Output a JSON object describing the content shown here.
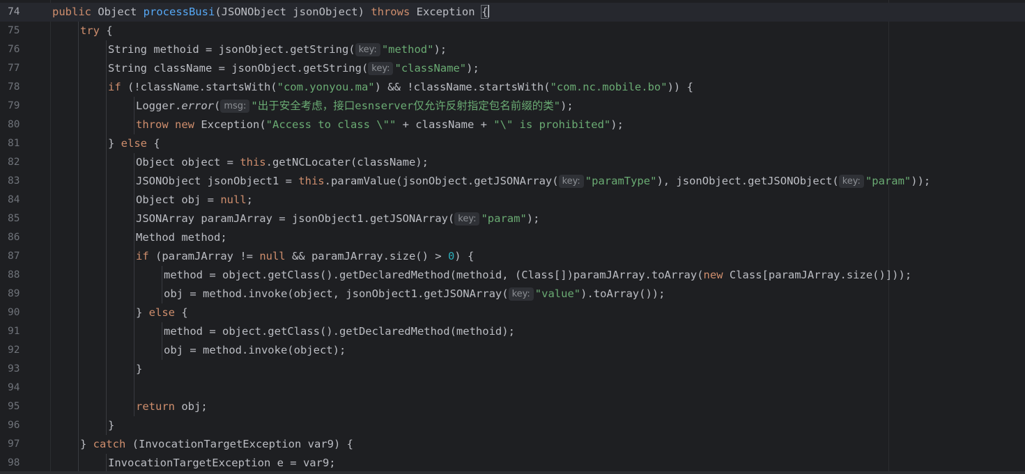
{
  "editor": {
    "lines": [
      {
        "n": "74",
        "indent": 1,
        "current": true,
        "tokens": [
          {
            "t": "public ",
            "c": "kw"
          },
          {
            "t": "Object "
          },
          {
            "t": "processBusi",
            "c": "fn"
          },
          {
            "t": "(JSONObject jsonObject) "
          },
          {
            "t": "throws ",
            "c": "kw"
          },
          {
            "t": "Exception "
          },
          {
            "t": "{",
            "c": "cursor-brace"
          },
          {
            "caret": true
          }
        ]
      },
      {
        "n": "75",
        "indent": 2,
        "tokens": [
          {
            "t": "try ",
            "c": "kw"
          },
          {
            "t": "{"
          }
        ]
      },
      {
        "n": "76",
        "indent": 3,
        "tokens": [
          {
            "t": "String methoid = jsonObject.getString("
          },
          {
            "hint": "key:"
          },
          {
            "t": "\"method\"",
            "c": "str"
          },
          {
            "t": ");"
          }
        ]
      },
      {
        "n": "77",
        "indent": 3,
        "tokens": [
          {
            "t": "String className = jsonObject.getString("
          },
          {
            "hint": "key:"
          },
          {
            "t": "\"className\"",
            "c": "str"
          },
          {
            "t": ");"
          }
        ]
      },
      {
        "n": "78",
        "indent": 3,
        "tokens": [
          {
            "t": "if ",
            "c": "kw"
          },
          {
            "t": "(!className.startsWith("
          },
          {
            "t": "\"com.yonyou.ma\"",
            "c": "str"
          },
          {
            "t": ") && !className.startsWith("
          },
          {
            "t": "\"com.nc.mobile.bo\"",
            "c": "str"
          },
          {
            "t": ")) {"
          }
        ]
      },
      {
        "n": "79",
        "indent": 4,
        "tokens": [
          {
            "t": "Logger."
          },
          {
            "t": "error",
            "c": "it"
          },
          {
            "t": "("
          },
          {
            "hint": "msg:"
          },
          {
            "t": "\"出于安全考虑，接口esnserver仅允许反射指定包名前缀的类\"",
            "c": "str"
          },
          {
            "t": ");"
          }
        ]
      },
      {
        "n": "80",
        "indent": 4,
        "tokens": [
          {
            "t": "throw ",
            "c": "kw"
          },
          {
            "t": "new ",
            "c": "kw"
          },
          {
            "t": "Exception("
          },
          {
            "t": "\"Access to class \\\"\"",
            "c": "str"
          },
          {
            "t": " + className + "
          },
          {
            "t": "\"\\\" is prohibited\"",
            "c": "str"
          },
          {
            "t": ");"
          }
        ]
      },
      {
        "n": "81",
        "indent": 3,
        "tokens": [
          {
            "t": "} "
          },
          {
            "t": "else ",
            "c": "kw"
          },
          {
            "t": "{"
          }
        ]
      },
      {
        "n": "82",
        "indent": 4,
        "tokens": [
          {
            "t": "Object object = "
          },
          {
            "t": "this",
            "c": "kw"
          },
          {
            "t": ".getNCLocater(className);"
          }
        ]
      },
      {
        "n": "83",
        "indent": 4,
        "tokens": [
          {
            "t": "JSONObject jsonObject1 = "
          },
          {
            "t": "this",
            "c": "kw"
          },
          {
            "t": ".paramValue(jsonObject.getJSONArray("
          },
          {
            "hint": "key:"
          },
          {
            "t": "\"paramType\"",
            "c": "str"
          },
          {
            "t": "), jsonObject.getJSONObject("
          },
          {
            "hint": "key:"
          },
          {
            "t": "\"param\"",
            "c": "str"
          },
          {
            "t": "));"
          }
        ]
      },
      {
        "n": "84",
        "indent": 4,
        "tokens": [
          {
            "t": "Object obj = "
          },
          {
            "t": "null",
            "c": "kw"
          },
          {
            "t": ";"
          }
        ]
      },
      {
        "n": "85",
        "indent": 4,
        "tokens": [
          {
            "t": "JSONArray paramJArray = jsonObject1.getJSONArray("
          },
          {
            "hint": "key:"
          },
          {
            "t": "\"param\"",
            "c": "str"
          },
          {
            "t": ");"
          }
        ]
      },
      {
        "n": "86",
        "indent": 4,
        "tokens": [
          {
            "t": "Method method;"
          }
        ]
      },
      {
        "n": "87",
        "indent": 4,
        "tokens": [
          {
            "t": "if ",
            "c": "kw"
          },
          {
            "t": "(paramJArray != "
          },
          {
            "t": "null",
            "c": "kw"
          },
          {
            "t": " && paramJArray.size() > "
          },
          {
            "t": "0",
            "c": "num"
          },
          {
            "t": ") {"
          }
        ]
      },
      {
        "n": "88",
        "indent": 5,
        "tokens": [
          {
            "t": "method = object.getClass().getDeclaredMethod(methoid, (Class[])paramJArray.toArray("
          },
          {
            "t": "new ",
            "c": "kw"
          },
          {
            "t": "Class[paramJArray.size()]));"
          }
        ]
      },
      {
        "n": "89",
        "indent": 5,
        "tokens": [
          {
            "t": "obj = method.invoke(object, jsonObject1.getJSONArray("
          },
          {
            "hint": "key:"
          },
          {
            "t": "\"value\"",
            "c": "str"
          },
          {
            "t": ").toArray());"
          }
        ]
      },
      {
        "n": "90",
        "indent": 4,
        "tokens": [
          {
            "t": "} "
          },
          {
            "t": "else ",
            "c": "kw"
          },
          {
            "t": "{"
          }
        ]
      },
      {
        "n": "91",
        "indent": 5,
        "tokens": [
          {
            "t": "method = object.getClass().getDeclaredMethod(methoid);"
          }
        ]
      },
      {
        "n": "92",
        "indent": 5,
        "tokens": [
          {
            "t": "obj = method.invoke(object);"
          }
        ]
      },
      {
        "n": "93",
        "indent": 4,
        "tokens": [
          {
            "t": "}"
          }
        ]
      },
      {
        "n": "94",
        "indent": 4,
        "tokens": []
      },
      {
        "n": "95",
        "indent": 4,
        "tokens": [
          {
            "t": "return ",
            "c": "kw"
          },
          {
            "t": "obj;"
          }
        ]
      },
      {
        "n": "96",
        "indent": 3,
        "tokens": [
          {
            "t": "}"
          }
        ]
      },
      {
        "n": "97",
        "indent": 2,
        "tokens": [
          {
            "t": "} "
          },
          {
            "t": "catch ",
            "c": "kw"
          },
          {
            "t": "(InvocationTargetException var9) {"
          }
        ]
      },
      {
        "n": "98",
        "indent": 3,
        "tokens": [
          {
            "t": "InvocationTargetException e = var9;"
          }
        ]
      }
    ],
    "colors": {
      "background": "#1e1f22",
      "keyword": "#cf8e6d",
      "function": "#56a8f5",
      "string": "#6aab73",
      "number": "#2aacb8",
      "text": "#bcbec4",
      "line_number": "#6f737a"
    }
  }
}
